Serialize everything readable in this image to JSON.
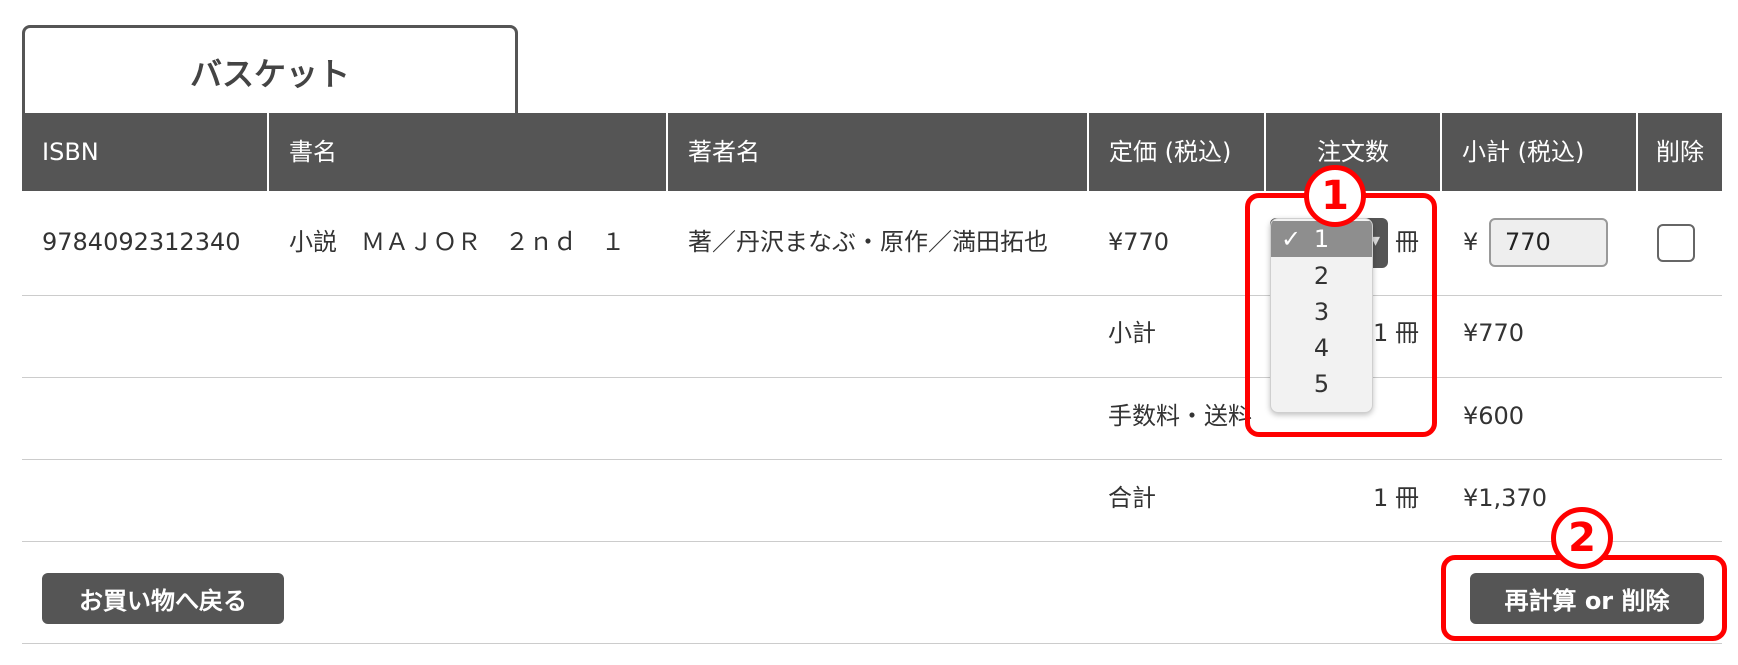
{
  "tab": {
    "label": "バスケット"
  },
  "table": {
    "headers": [
      "ISBN",
      "書名",
      "著者名",
      "定価 (税込)",
      "注文数",
      "小計 (税込)",
      "削除"
    ],
    "row": {
      "isbn": "9784092312340",
      "title": "小説　ＭＡＪＯＲ　２ｎｄ　１",
      "author": "著／丹沢まなぶ・原作／満田拓也",
      "price": "¥770",
      "qty_selected": "1",
      "qty_options": [
        "1",
        "2",
        "3",
        "4",
        "5"
      ],
      "qty_unit": "冊",
      "yen_prefix": "¥",
      "subtotal_value": "770"
    },
    "summary": {
      "subtotal_label": "小計",
      "subtotal_qty": "1",
      "subtotal_unit": "冊",
      "subtotal_amount": "¥770",
      "fee_label": "手数料・送料",
      "fee_amount": "¥600",
      "total_label": "合計",
      "total_qty": "1",
      "total_unit": "冊",
      "total_amount": "¥1,370"
    }
  },
  "buttons": {
    "back": "お買い物へ戻る",
    "recalc": "再計算 or 削除"
  },
  "annotations": {
    "badge1": "1",
    "badge2": "2",
    "color": "#ff0000"
  },
  "icons": {
    "check": "checkmark-icon",
    "select_arrow": "chevron-down-icon"
  }
}
